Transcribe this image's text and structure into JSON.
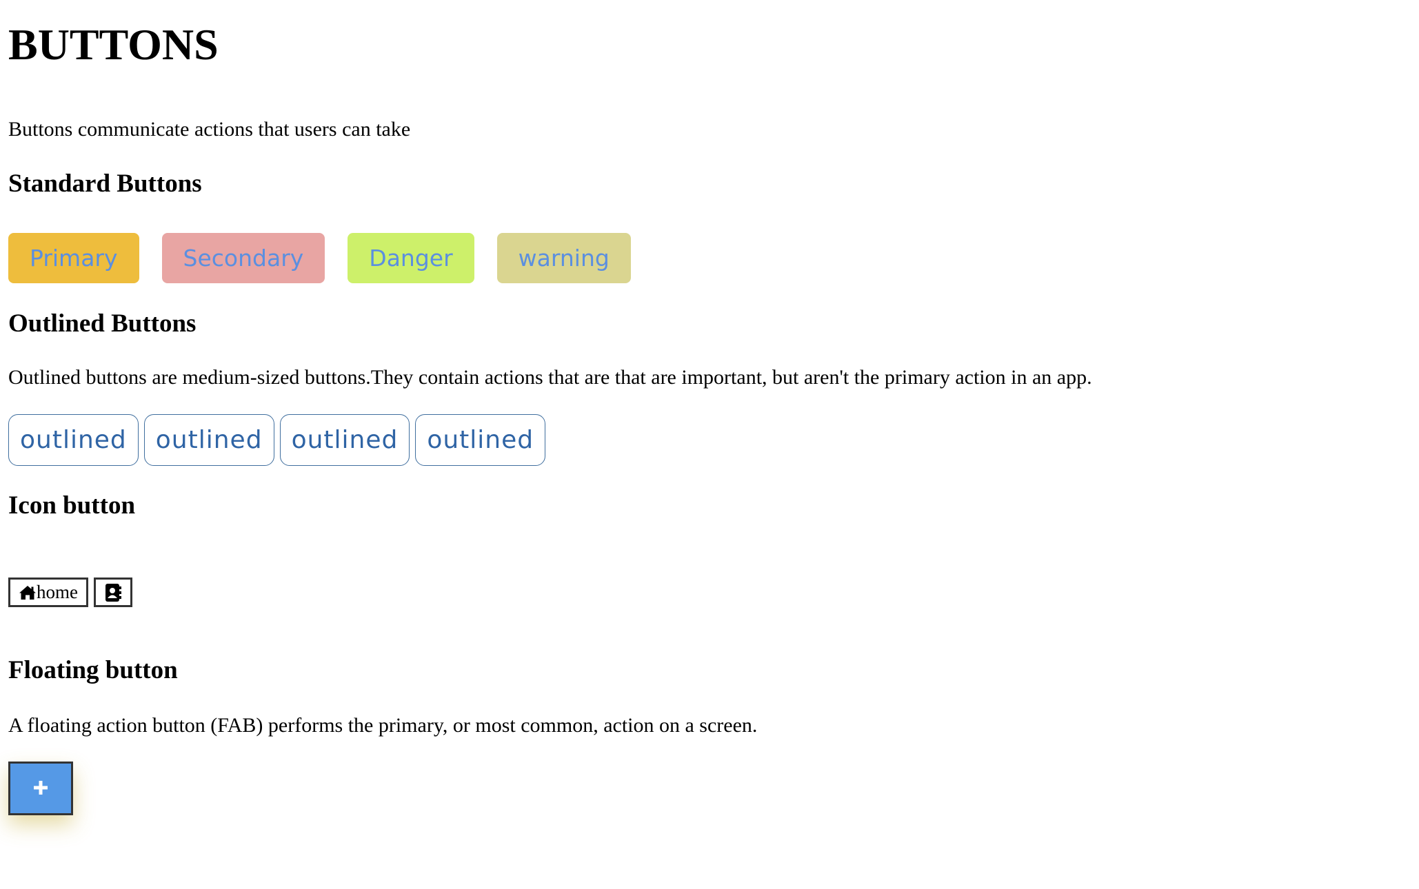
{
  "page": {
    "title": "BUTTONS",
    "intro": "Buttons communicate actions that users can take"
  },
  "standard": {
    "heading": "Standard Buttons",
    "buttons": [
      {
        "label": "Primary",
        "color": "#eebd3d"
      },
      {
        "label": "Secondary",
        "color": "#e8a5a3"
      },
      {
        "label": "Danger",
        "color": "#cdf06a"
      },
      {
        "label": "warning",
        "color": "#dad590"
      }
    ],
    "text_color": "#5b8fe0"
  },
  "outlined": {
    "heading": "Outlined Buttons",
    "description": "Outlined buttons are medium-sized buttons.They contain actions that are that are important, but aren't the primary action in an app.",
    "buttons": [
      {
        "label": "outlined"
      },
      {
        "label": "outlined"
      },
      {
        "label": "outlined"
      },
      {
        "label": "outlined"
      }
    ],
    "border_color": "#3f6e9e"
  },
  "icon_buttons": {
    "heading": "Icon button",
    "home": {
      "icon": "home-icon",
      "label": "home"
    },
    "contact": {
      "icon": "address-book-icon"
    }
  },
  "floating": {
    "heading": "Floating button",
    "description": "A floating action button (FAB) performs the primary, or most common, action on a screen.",
    "fab_icon": "plus-icon",
    "fab_color": "#5599e6"
  }
}
